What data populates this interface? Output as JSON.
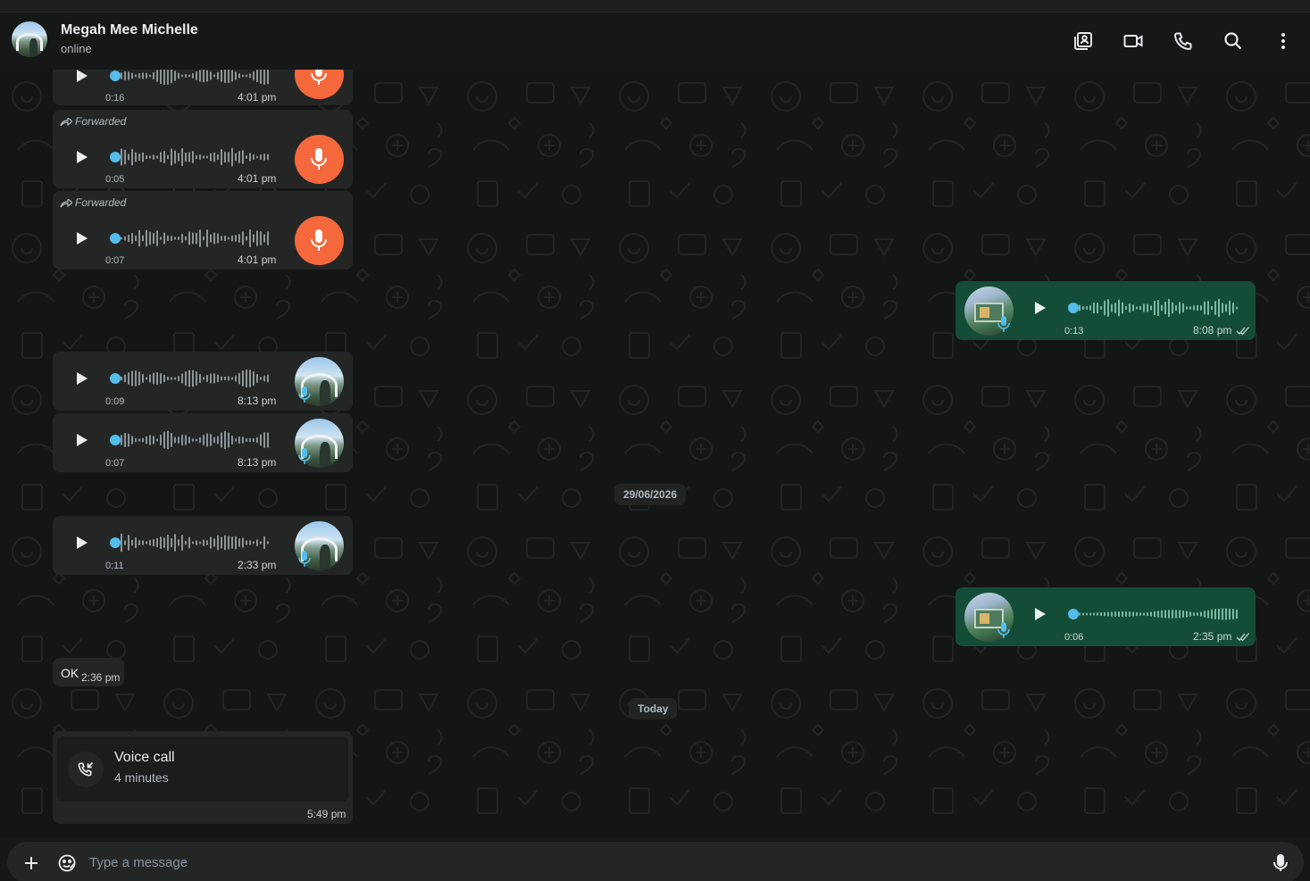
{
  "contact": {
    "name": "Megah Mee Michelle",
    "status": "online"
  },
  "header_icons": [
    "contact-gallery-icon",
    "video-call-icon",
    "phone-icon",
    "search-icon",
    "menu-dots-icon"
  ],
  "colors": {
    "background": "#161717",
    "incoming_bubble": "#242626",
    "outgoing_bubble": "#144d37",
    "accent_orange": "#f4683b",
    "progress_dot": "#53bdeb"
  },
  "messages": {
    "in1": {
      "duration": "0:16",
      "time": "4:01 pm"
    },
    "in2": {
      "label": "Forwarded",
      "duration": "0:05",
      "time": "4:01 pm"
    },
    "in3": {
      "label": "Forwarded",
      "duration": "0:07",
      "time": "4:01 pm"
    },
    "out1": {
      "duration": "0:13",
      "time": "8:08 pm"
    },
    "in4": {
      "duration": "0:09",
      "time": "8:13 pm"
    },
    "in5": {
      "duration": "0:07",
      "time": "8:13 pm"
    },
    "date1": "29/06/2026",
    "in6": {
      "duration": "0:11",
      "time": "2:33 pm"
    },
    "out2": {
      "duration": "0:06",
      "time": "2:35 pm"
    },
    "ok": {
      "text": "OK",
      "time": "2:36 pm"
    },
    "date2": "Today",
    "call": {
      "title": "Voice call",
      "subtitle": "4 minutes",
      "time": "5:49 pm"
    }
  },
  "composer": {
    "placeholder": "Type a message"
  }
}
